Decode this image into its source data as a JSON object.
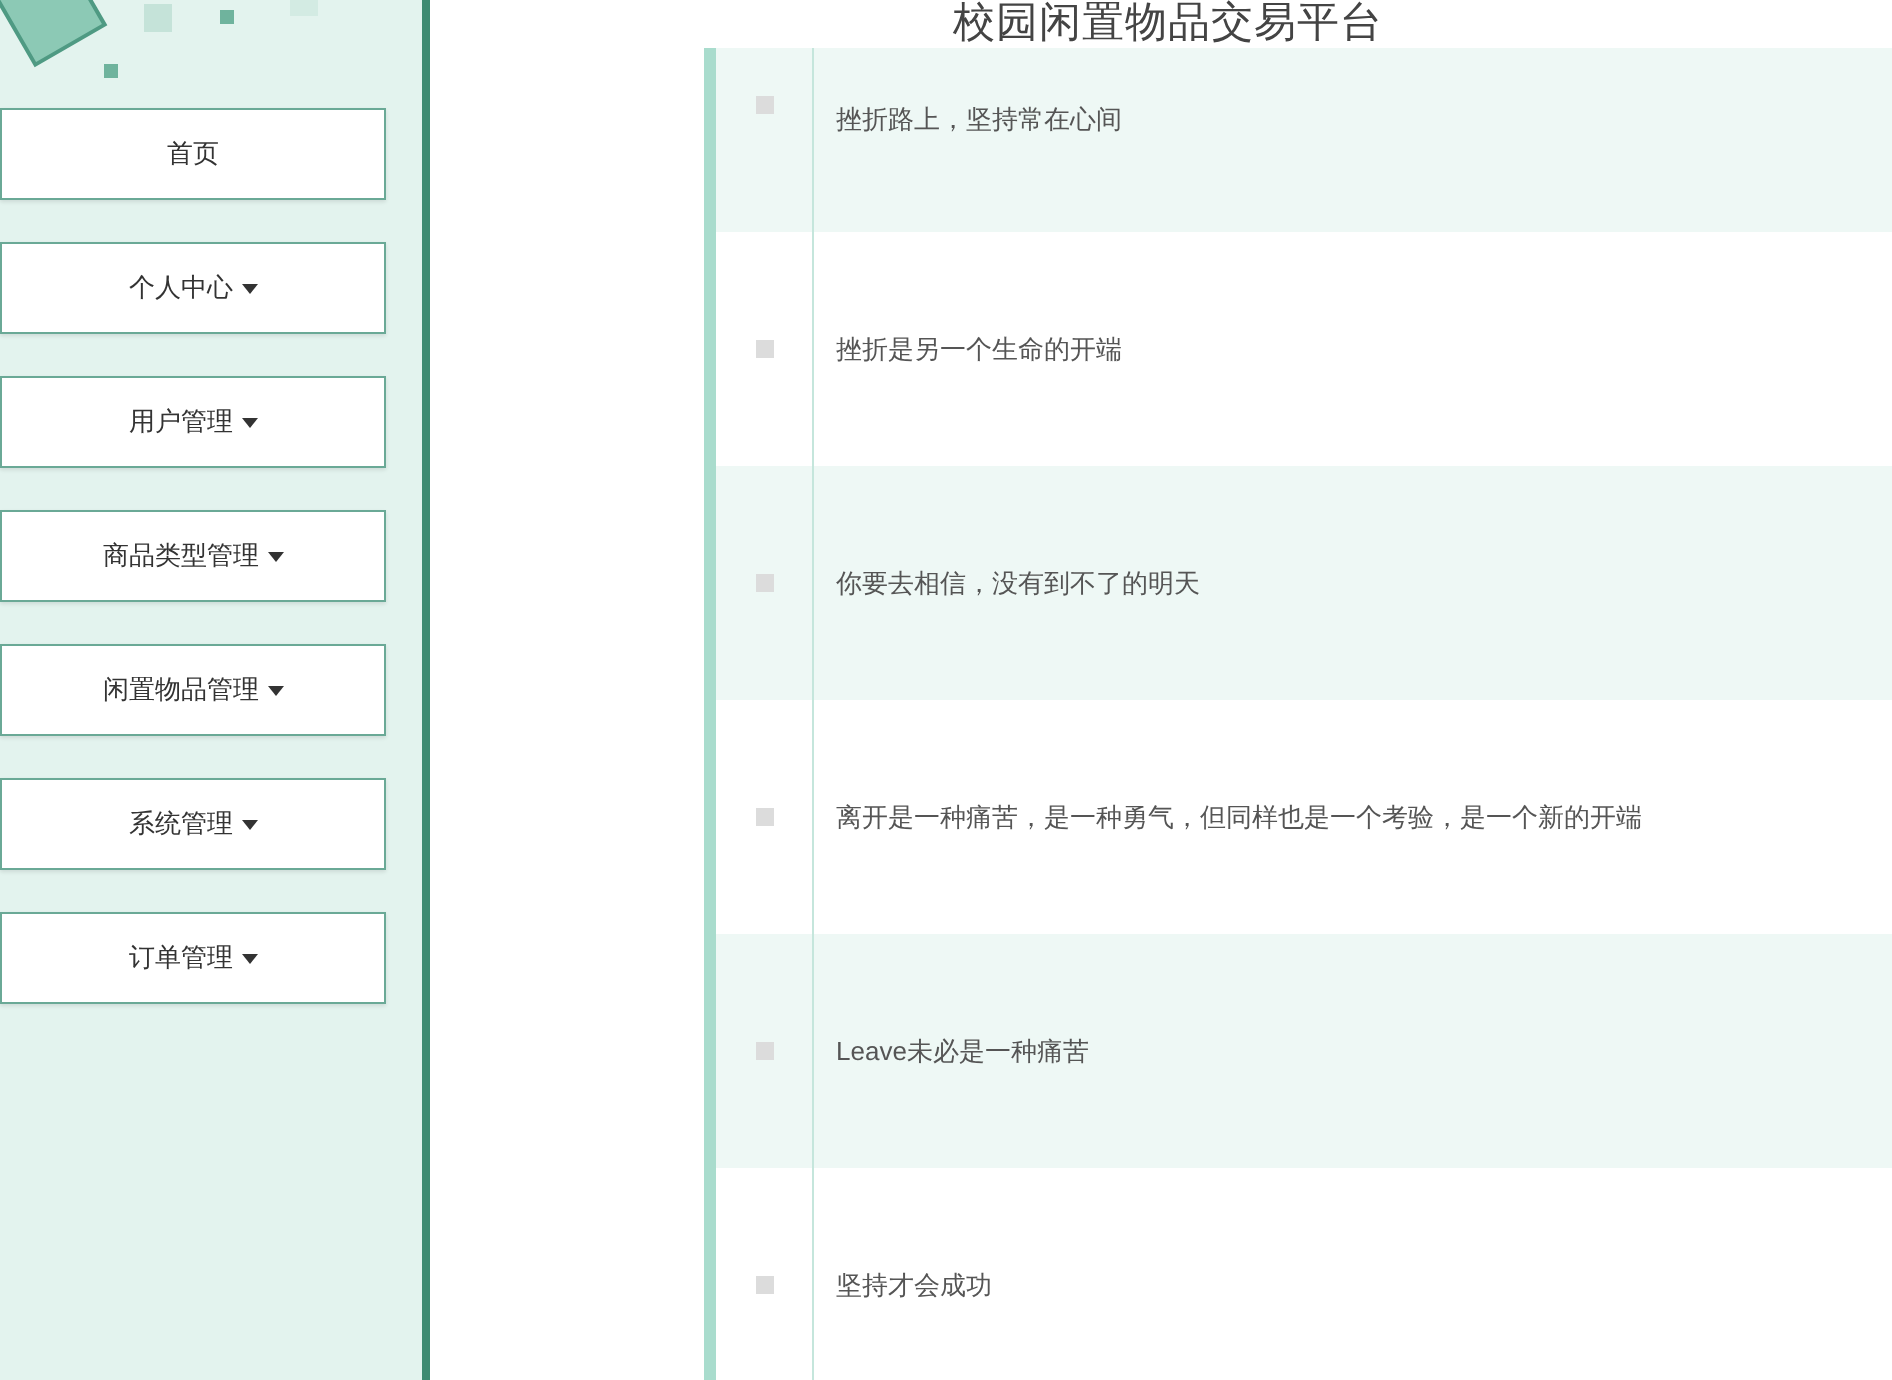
{
  "sidebar": {
    "items": [
      {
        "label": "首页",
        "has_dropdown": false
      },
      {
        "label": "个人中心",
        "has_dropdown": true
      },
      {
        "label": "用户管理",
        "has_dropdown": true
      },
      {
        "label": "商品类型管理",
        "has_dropdown": true
      },
      {
        "label": "闲置物品管理",
        "has_dropdown": true
      },
      {
        "label": "系统管理",
        "has_dropdown": true
      },
      {
        "label": "订单管理",
        "has_dropdown": true
      }
    ]
  },
  "header": {
    "title": "校园闲置物品交易平台"
  },
  "list": {
    "rows": [
      {
        "text": "挫折路上，坚持常在心间",
        "checked": false
      },
      {
        "text": "挫折是另一个生命的开端",
        "checked": false
      },
      {
        "text": "你要去相信，没有到不了的明天",
        "checked": false
      },
      {
        "text": "离开是一种痛苦，是一种勇气，但同样也是一个考验，是一个新的开端",
        "checked": false
      },
      {
        "text": "Leave未必是一种痛苦",
        "checked": false
      },
      {
        "text": "坚持才会成功",
        "checked": false
      }
    ]
  }
}
